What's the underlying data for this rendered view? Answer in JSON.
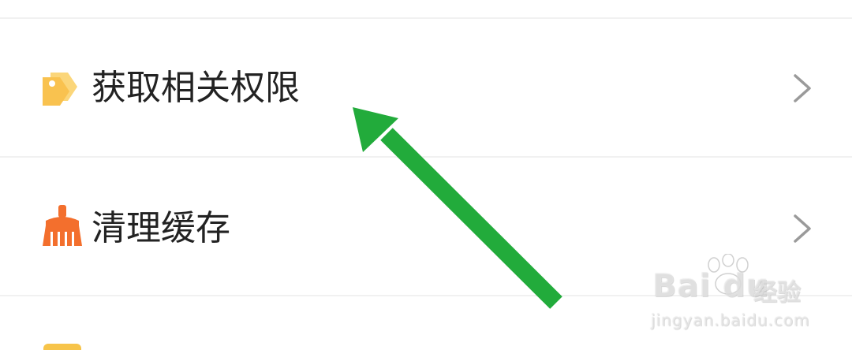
{
  "settings_list": {
    "items": [
      {
        "label": "获取相关权限",
        "icon": "tag-icon",
        "icon_color": "#f9c24f"
      },
      {
        "label": "清理缓存",
        "icon": "broom-icon",
        "icon_color": "#f36f2d"
      }
    ],
    "partial_item_icon_color": "#f7c44a"
  },
  "annotation_arrow": {
    "color": "#22ab3b"
  },
  "watermark": {
    "brand": "Bai du",
    "brand_cn": "经验",
    "url": "jingyan.baidu.com"
  }
}
